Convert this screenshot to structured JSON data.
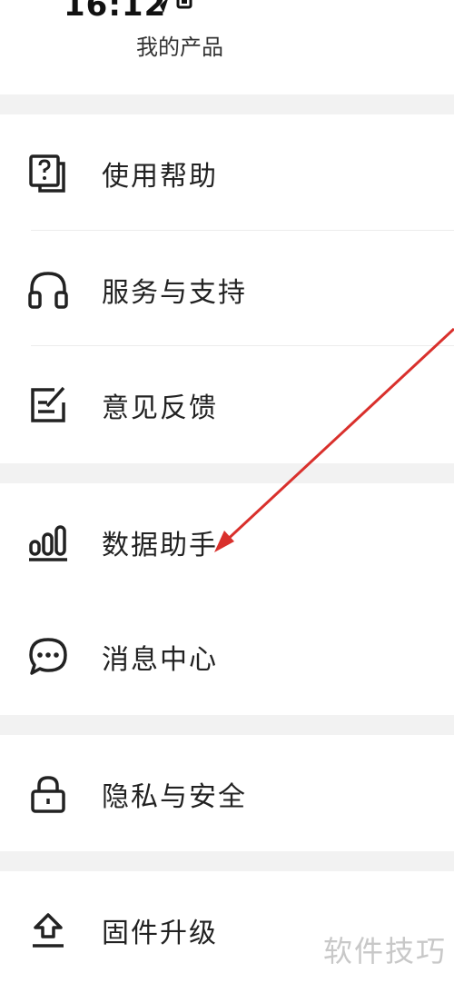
{
  "status_bar": {
    "time": "16:12"
  },
  "header": {
    "tab_label": "我的产品"
  },
  "menu": {
    "groups": [
      {
        "items": [
          {
            "label": "使用帮助",
            "icon": "help-document-icon"
          },
          {
            "label": "服务与支持",
            "icon": "headphones-icon"
          },
          {
            "label": "意见反馈",
            "icon": "feedback-edit-icon"
          }
        ]
      },
      {
        "items": [
          {
            "label": "数据助手",
            "icon": "bar-chart-icon"
          },
          {
            "label": "消息中心",
            "icon": "chat-bubble-icon"
          }
        ]
      },
      {
        "items": [
          {
            "label": "隐私与安全",
            "icon": "lock-icon"
          }
        ]
      },
      {
        "items": [
          {
            "label": "固件升级",
            "icon": "upload-icon"
          }
        ]
      }
    ]
  },
  "watermark": {
    "text": "软件技巧"
  },
  "colors": {
    "background": "#ffffff",
    "separator": "#f2f2f2",
    "text": "#222222",
    "annotation_arrow": "#d9302c",
    "watermark": "#c8c8c8"
  }
}
